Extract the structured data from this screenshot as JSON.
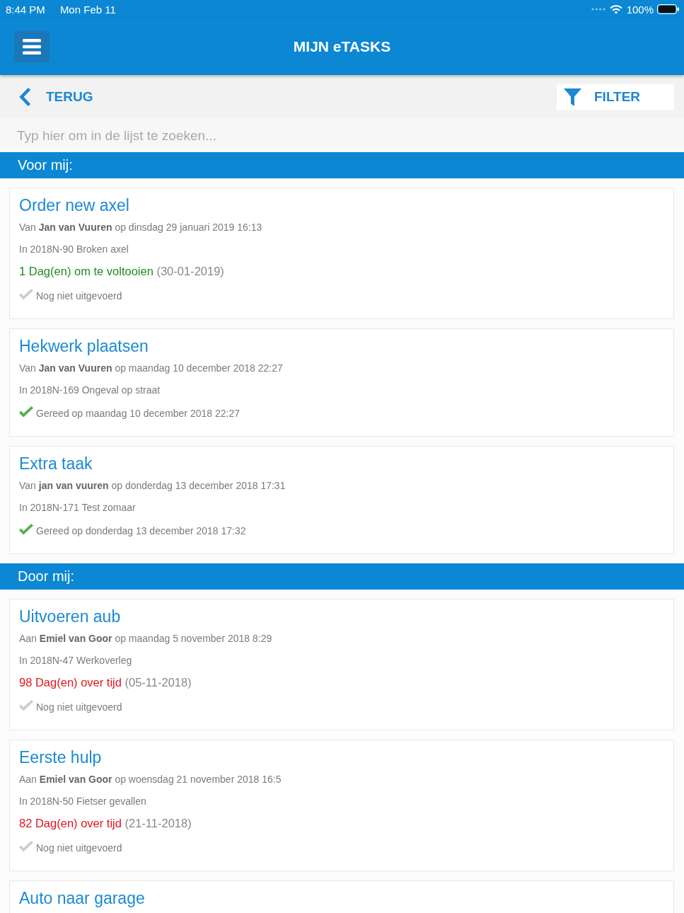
{
  "status_bar": {
    "time": "8:44 PM",
    "date": "Mon Feb 11",
    "battery": "100%"
  },
  "header": {
    "title": "MIJN eTASKS"
  },
  "toolbar": {
    "back": "TERUG",
    "filter": "FILTER"
  },
  "search": {
    "placeholder": "Typ hier om in de lijst te zoeken..."
  },
  "sections": [
    {
      "title": "Voor mij:",
      "tasks": [
        {
          "title": "Order new axel",
          "meta": "Van **Jan van Vuuren** op dinsdag 29 januari 2019 16:13",
          "context": "In 2018N-90 Broken axel",
          "due": {
            "label": "1 Dag(en) om te voltooien",
            "date": "(30-01-2019)",
            "overdue": false
          },
          "status": {
            "label": "Nog niet uitgevoerd",
            "done": false
          }
        },
        {
          "title": "Hekwerk plaatsen",
          "meta": "Van **Jan van Vuuren** op maandag 10 december 2018 22:27",
          "context": "In 2018N-169 Ongeval op straat",
          "status": {
            "label": "Gereed op maandag 10 december 2018 22:27",
            "done": true
          }
        },
        {
          "title": "Extra taak",
          "meta": "Van **jan van vuuren** op donderdag 13 december 2018 17:31",
          "context": "In 2018N-171 Test zomaar",
          "status": {
            "label": "Gereed op donderdag 13 december 2018 17:32",
            "done": true
          }
        }
      ]
    },
    {
      "title": "Door mij:",
      "tasks": [
        {
          "title": "Uitvoeren aub",
          "meta": "Aan **Emiel van Goor** op maandag 5 november 2018 8:29",
          "context": "In 2018N-47 Werkoverleg",
          "due": {
            "label": "98 Dag(en) over tijd",
            "date": "(05-11-2018)",
            "overdue": true
          },
          "status": {
            "label": "Nog niet uitgevoerd",
            "done": false
          }
        },
        {
          "title": "Eerste hulp",
          "meta": "Aan **Emiel van Goor** op woensdag 21 november 2018 16:5",
          "context": "In 2018N-50 Fietser gevallen",
          "due": {
            "label": "82 Dag(en) over tijd",
            "date": "(21-11-2018)",
            "overdue": true
          },
          "status": {
            "label": "Nog niet uitgevoerd",
            "done": false
          }
        },
        {
          "title": "Auto naar garage"
        }
      ]
    }
  ]
}
